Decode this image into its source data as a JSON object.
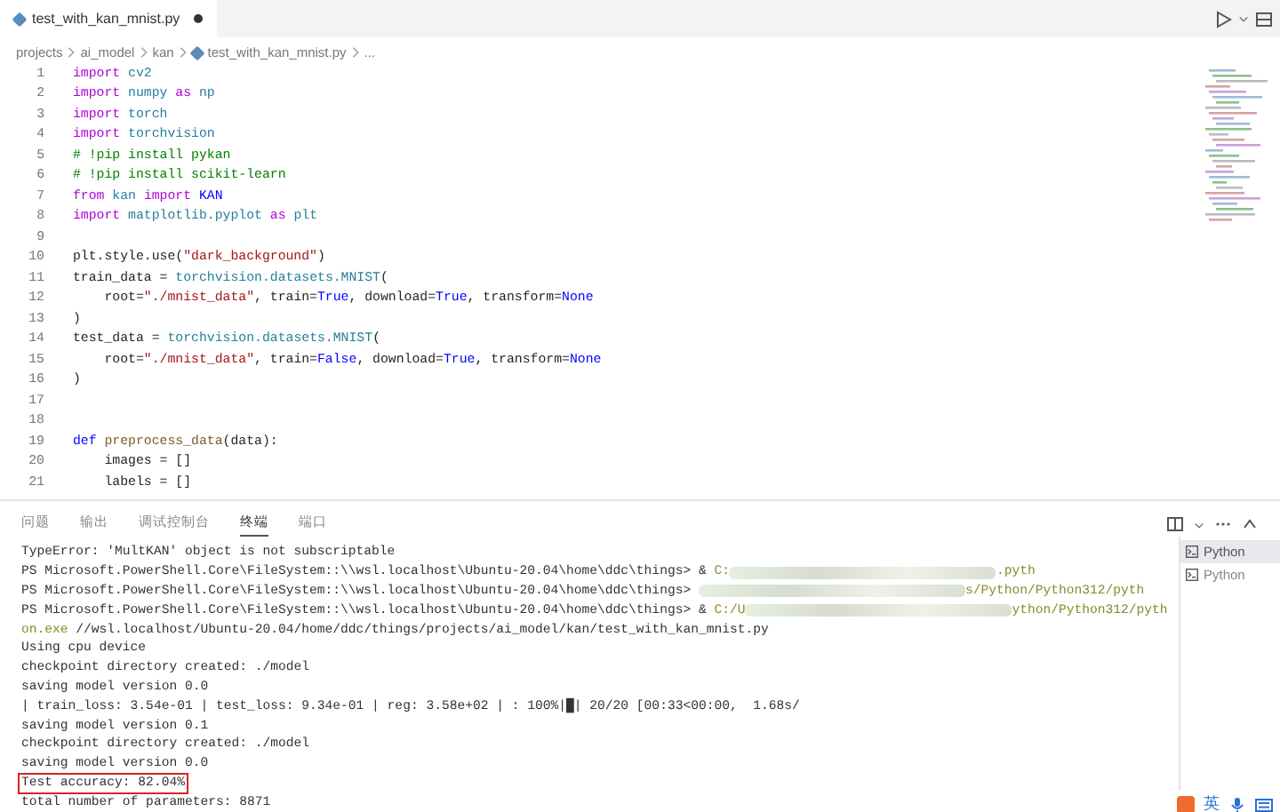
{
  "editor_tabs": [
    {
      "label": "test_with_kan_mnist.py",
      "selected": true,
      "modified": true
    }
  ],
  "breadcrumb": [
    {
      "label": "projects",
      "kind": "folder"
    },
    {
      "label": "ai_model",
      "kind": "folder"
    },
    {
      "label": "kan",
      "kind": "folder"
    },
    {
      "label": "test_with_kan_mnist.py",
      "kind": "file"
    },
    {
      "label": "...",
      "kind": "more"
    }
  ],
  "code_lines": [
    {
      "number": "1",
      "tokens": [
        {
          "text": "import",
          "kind": "kw"
        },
        {
          "text": " cv2",
          "kind": "mod"
        }
      ]
    },
    {
      "number": "2",
      "tokens": [
        {
          "text": "import",
          "kind": "kw"
        },
        {
          "text": " numpy ",
          "kind": "mod"
        },
        {
          "text": "as",
          "kind": "kw"
        },
        {
          "text": " np",
          "kind": "mod"
        }
      ]
    },
    {
      "number": "3",
      "tokens": [
        {
          "text": "import",
          "kind": "kw"
        },
        {
          "text": " torch",
          "kind": "mod"
        }
      ]
    },
    {
      "number": "4",
      "tokens": [
        {
          "text": "import",
          "kind": "kw"
        },
        {
          "text": " torchvision",
          "kind": "mod"
        }
      ]
    },
    {
      "number": "5",
      "tokens": [
        {
          "text": "# !pip install pykan",
          "kind": "cmt"
        }
      ]
    },
    {
      "number": "6",
      "tokens": [
        {
          "text": "# !pip install scikit-learn",
          "kind": "cmt"
        }
      ]
    },
    {
      "number": "7",
      "tokens": [
        {
          "text": "from",
          "kind": "kw"
        },
        {
          "text": " kan ",
          "kind": "mod"
        },
        {
          "text": "import",
          "kind": "kw"
        },
        {
          "text": " KAN",
          "kind": "const"
        }
      ]
    },
    {
      "number": "8",
      "tokens": [
        {
          "text": "import",
          "kind": "kw"
        },
        {
          "text": " matplotlib.pyplot ",
          "kind": "mod"
        },
        {
          "text": "as",
          "kind": "kw"
        },
        {
          "text": " plt",
          "kind": "mod"
        }
      ]
    },
    {
      "number": "9"
    },
    {
      "number": "10",
      "tokens": [
        {
          "text": "plt.style.use(",
          "kind": "plain"
        },
        {
          "text": "\"dark_background\"",
          "kind": "str"
        },
        {
          "text": ")",
          "kind": "plain"
        }
      ]
    },
    {
      "number": "11",
      "tokens": [
        {
          "text": "train_data = ",
          "kind": "plain"
        },
        {
          "text": "torchvision.datasets.MNIST",
          "kind": "cls"
        },
        {
          "text": "(",
          "kind": "plain"
        }
      ]
    },
    {
      "number": "12",
      "tokens": [
        {
          "text": "    root=",
          "kind": "plain"
        },
        {
          "text": "\"./mnist_data\"",
          "kind": "str"
        },
        {
          "text": ", train=",
          "kind": "plain"
        },
        {
          "text": "True",
          "kind": "const"
        },
        {
          "text": ", download=",
          "kind": "plain"
        },
        {
          "text": "True",
          "kind": "const"
        },
        {
          "text": ", transform=",
          "kind": "plain"
        },
        {
          "text": "None",
          "kind": "const"
        }
      ]
    },
    {
      "number": "13",
      "tokens": [
        {
          "text": ")",
          "kind": "plain"
        }
      ]
    },
    {
      "number": "14",
      "tokens": [
        {
          "text": "test_data = ",
          "kind": "plain"
        },
        {
          "text": "torchvision.datasets.MNIST",
          "kind": "cls"
        },
        {
          "text": "(",
          "kind": "plain"
        }
      ]
    },
    {
      "number": "15",
      "tokens": [
        {
          "text": "    root=",
          "kind": "plain"
        },
        {
          "text": "\"./mnist_data\"",
          "kind": "str"
        },
        {
          "text": ", train=",
          "kind": "plain"
        },
        {
          "text": "False",
          "kind": "const"
        },
        {
          "text": ", download=",
          "kind": "plain"
        },
        {
          "text": "True",
          "kind": "const"
        },
        {
          "text": ", transform=",
          "kind": "plain"
        },
        {
          "text": "None",
          "kind": "const"
        }
      ]
    },
    {
      "number": "16",
      "tokens": [
        {
          "text": ")",
          "kind": "plain"
        }
      ]
    },
    {
      "number": "17"
    },
    {
      "number": "18"
    },
    {
      "number": "19",
      "tokens": [
        {
          "text": "def",
          "kind": "const"
        },
        {
          "text": " preprocess_data",
          "kind": "fn"
        },
        {
          "text": "(data):",
          "kind": "plain"
        }
      ]
    },
    {
      "number": "20",
      "tokens": [
        {
          "text": "    images = []",
          "kind": "plain"
        }
      ]
    },
    {
      "number": "21",
      "tokens": [
        {
          "text": "    labels = []",
          "kind": "plain"
        }
      ]
    }
  ],
  "panel_tabs": [
    {
      "label": "问题",
      "selected": false
    },
    {
      "label": "输出",
      "selected": false
    },
    {
      "label": "调试控制台",
      "selected": false
    },
    {
      "label": "终端",
      "selected": true
    },
    {
      "label": "端口",
      "selected": false
    }
  ],
  "terminal_lines": [
    {
      "segments": [
        {
          "text": "TypeError: 'MultKAN' object is not subscriptable",
          "kind": "plain"
        }
      ]
    },
    {
      "segments": [
        {
          "text": "PS Microsoft.PowerShell.Core\\FileSystem::\\\\wsl.localhost\\Ubuntu-20.04\\home\\ddc\\things> & ",
          "kind": "plain"
        },
        {
          "text": "C:",
          "kind": "path"
        },
        {
          "kind": "blur"
        },
        {
          "text": ".pyth",
          "kind": "path"
        }
      ]
    },
    {
      "segments": [
        {
          "text": "PS Microsoft.PowerShell.Core\\FileSystem::\\\\wsl.localhost\\Ubuntu-20.04\\home\\ddc\\things> ",
          "kind": "plain"
        },
        {
          "kind": "blur"
        },
        {
          "text": "s/Python/Python312/pyth",
          "kind": "path"
        }
      ]
    },
    {
      "segments": [
        {
          "text": "PS Microsoft.PowerShell.Core\\FileSystem::\\\\wsl.localhost\\Ubuntu-20.04\\home\\ddc\\things> & ",
          "kind": "plain"
        },
        {
          "text": "C:/U",
          "kind": "path"
        },
        {
          "kind": "blur"
        },
        {
          "text": "ython/Python312/pyth",
          "kind": "path"
        }
      ]
    },
    {
      "segments": [
        {
          "text": "on.exe",
          "kind": "path"
        },
        {
          "text": " //wsl.localhost/Ubuntu-20.04/home/ddc/things/projects/ai_model/kan/test_with_kan_mnist.py",
          "kind": "plain"
        }
      ]
    },
    {
      "segments": [
        {
          "text": "Using cpu device",
          "kind": "plain"
        }
      ]
    },
    {
      "segments": [
        {
          "text": "checkpoint directory created: ./model",
          "kind": "plain"
        }
      ]
    },
    {
      "segments": [
        {
          "text": "saving model version 0.0",
          "kind": "plain"
        }
      ]
    },
    {
      "segments": [
        {
          "text": "| train_loss: 3.54e-01 | test_loss: 9.34e-01 | reg: 3.58e+02 | : 100%|█| 20/20 [00:33<00:00,  1.68s/",
          "kind": "plain"
        }
      ]
    },
    {
      "segments": [
        {
          "text": "saving model version 0.1",
          "kind": "plain"
        }
      ]
    },
    {
      "segments": [
        {
          "text": "checkpoint directory created: ./model",
          "kind": "plain"
        }
      ]
    },
    {
      "segments": [
        {
          "text": "saving model version 0.0",
          "kind": "plain"
        }
      ]
    },
    {
      "segments": [
        {
          "text": "Test accuracy: 82.04%",
          "kind": "plain"
        }
      ],
      "highlighted": true
    },
    {
      "segments": [
        {
          "text": "total number of parameters: 8871",
          "kind": "plain"
        }
      ]
    }
  ],
  "terminal_list": [
    {
      "label": "Python",
      "selected": true
    },
    {
      "label": "Python",
      "selected": false
    }
  ],
  "ime_toolbar": {
    "language": "英"
  }
}
